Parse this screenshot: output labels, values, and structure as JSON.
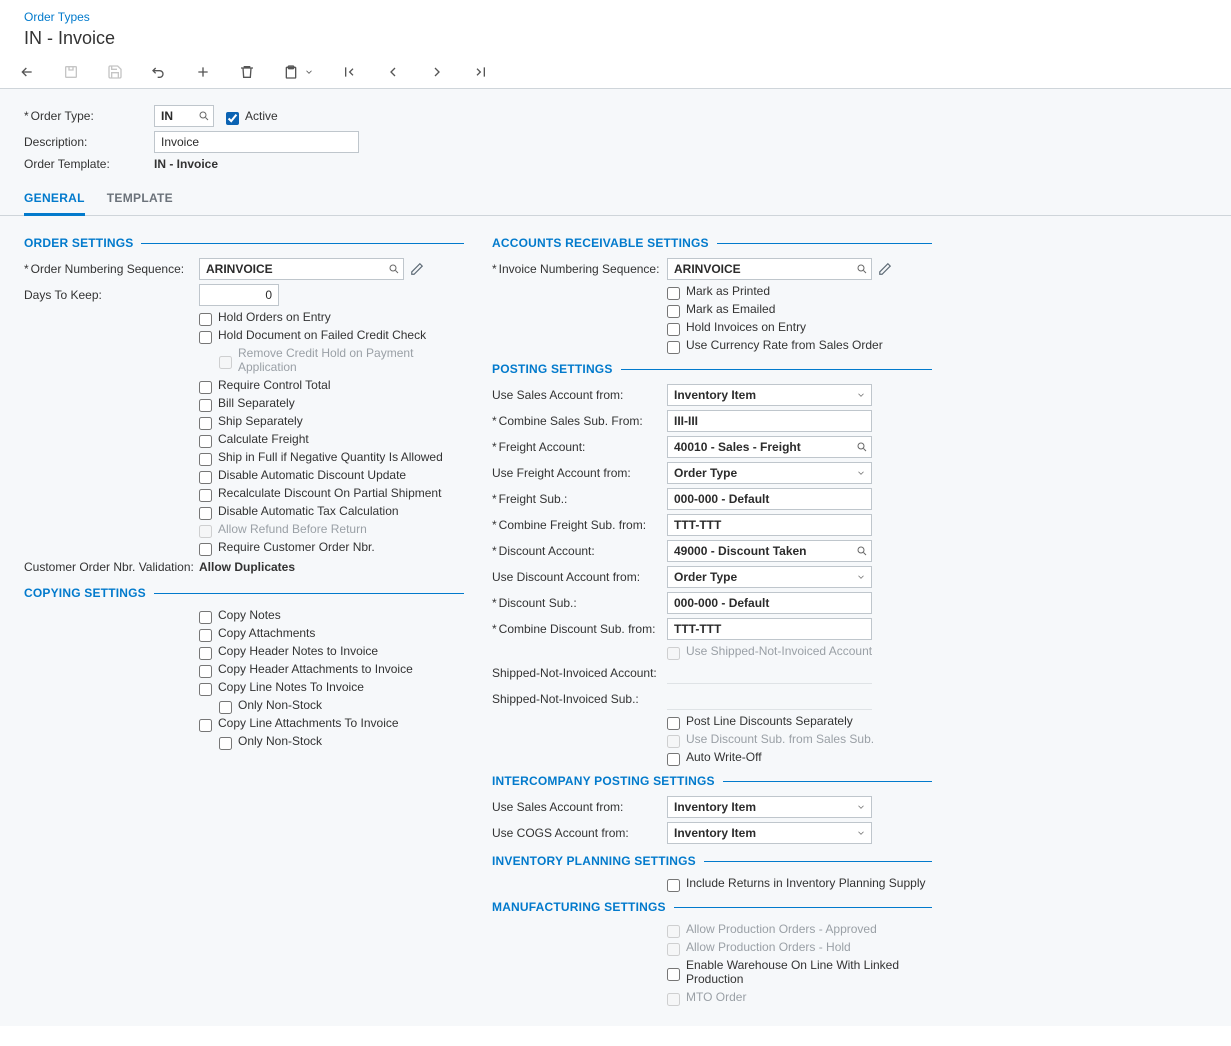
{
  "breadcrumb": {
    "link": "Order Types"
  },
  "pageTitle": "IN - Invoice",
  "header": {
    "orderTypeLabel": "Order Type:",
    "orderTypeValue": "IN",
    "activeLabel": "Active",
    "descriptionLabel": "Description:",
    "descriptionValue": "Invoice",
    "orderTemplateLabel": "Order Template:",
    "orderTemplateValue": "IN - Invoice"
  },
  "tabs": {
    "general": "GENERAL",
    "template": "TEMPLATE"
  },
  "secOrderSettings": {
    "title": "ORDER SETTINGS",
    "orderNumSeqLabel": "Order Numbering Sequence:",
    "orderNumSeqValue": "ARINVOICE",
    "daysToKeepLabel": "Days To Keep:",
    "daysToKeepValue": "0",
    "holdOrders": "Hold Orders on Entry",
    "holdDoc": "Hold Document on Failed Credit Check",
    "removeCredit": "Remove Credit Hold on Payment Application",
    "requireCtrl": "Require Control Total",
    "billSep": "Bill Separately",
    "shipSep": "Ship Separately",
    "calcFreight": "Calculate Freight",
    "shipFullNeg": "Ship in Full if Negative Quantity Is Allowed",
    "disableAutoDisc": "Disable Automatic Discount Update",
    "recalcDisc": "Recalculate Discount On Partial Shipment",
    "disableAutoTax": "Disable Automatic Tax Calculation",
    "allowRefund": "Allow Refund Before Return",
    "requireCustOrd": "Require Customer Order Nbr.",
    "custOrdNbrValLabel": "Customer Order Nbr. Validation:",
    "custOrdNbrValValue": "Allow Duplicates"
  },
  "secCopySettings": {
    "title": "COPYING SETTINGS",
    "copyNotes": "Copy Notes",
    "copyAttach": "Copy Attachments",
    "copyHdrNotes": "Copy Header Notes to Invoice",
    "copyHdrAttach": "Copy Header Attachments to Invoice",
    "copyLineNotes": "Copy Line Notes To Invoice",
    "onlyNonStock1": "Only Non-Stock",
    "copyLineAttach": "Copy Line Attachments To Invoice",
    "onlyNonStock2": "Only Non-Stock"
  },
  "secAR": {
    "title": "ACCOUNTS RECEIVABLE SETTINGS",
    "invNumSeqLabel": "Invoice Numbering Sequence:",
    "invNumSeqValue": "ARINVOICE",
    "markPrinted": "Mark as Printed",
    "markEmailed": "Mark as Emailed",
    "holdInvoices": "Hold Invoices on Entry",
    "useCurrRate": "Use Currency Rate from Sales Order"
  },
  "secPosting": {
    "title": "POSTING SETTINGS",
    "useSalesAcctLabel": "Use Sales Account from:",
    "useSalesAcctValue": "Inventory Item",
    "combineSalesSubLabel": "Combine Sales Sub. From:",
    "combineSalesSubValue": "III-III",
    "freightAcctLabel": "Freight Account:",
    "freightAcctValue": "40010 - Sales - Freight",
    "useFreightAcctLabel": "Use Freight Account from:",
    "useFreightAcctValue": "Order Type",
    "freightSubLabel": "Freight Sub.:",
    "freightSubValue": "000-000 - Default",
    "combineFreightSubLabel": "Combine Freight Sub. from:",
    "combineFreightSubValue": "TTT-TTT",
    "discAcctLabel": "Discount Account:",
    "discAcctValue": "49000 - Discount Taken",
    "useDiscAcctLabel": "Use Discount Account from:",
    "useDiscAcctValue": "Order Type",
    "discSubLabel": "Discount Sub.:",
    "discSubValue": "000-000 - Default",
    "combineDiscSubLabel": "Combine Discount Sub. from:",
    "combineDiscSubValue": "TTT-TTT",
    "useShipNotInv": "Use Shipped-Not-Invoiced Account",
    "shipNotInvAcctLabel": "Shipped-Not-Invoiced Account:",
    "shipNotInvSubLabel": "Shipped-Not-Invoiced Sub.:",
    "postLineDisc": "Post Line Discounts Separately",
    "useDiscSubSales": "Use Discount Sub. from Sales Sub.",
    "autoWriteOff": "Auto Write-Off"
  },
  "secIntercompany": {
    "title": "INTERCOMPANY POSTING SETTINGS",
    "useSalesAcctLabel": "Use Sales Account from:",
    "useSalesAcctValue": "Inventory Item",
    "useCogsAcctLabel": "Use COGS Account from:",
    "useCogsAcctValue": "Inventory Item"
  },
  "secInvPlan": {
    "title": "INVENTORY PLANNING SETTINGS",
    "includeReturns": "Include Returns in Inventory Planning Supply"
  },
  "secMfg": {
    "title": "MANUFACTURING SETTINGS",
    "allowProdApproved": "Allow Production Orders - Approved",
    "allowProdHold": "Allow Production Orders - Hold",
    "enableWhse": "Enable Warehouse On Line With Linked Production",
    "mtoOrder": "MTO Order"
  }
}
